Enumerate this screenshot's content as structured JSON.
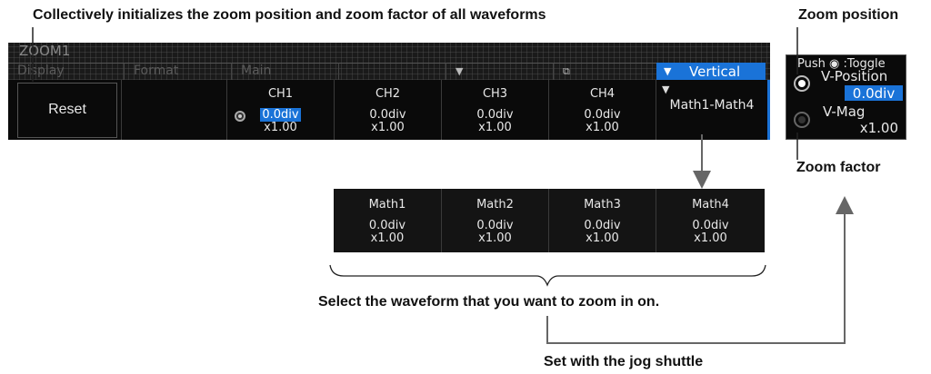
{
  "annotations": {
    "reset_note": "Collectively initializes the zoom position and zoom factor of all waveforms",
    "zoom_position": "Zoom position",
    "zoom_factor": "Zoom factor",
    "select_note": "Select the waveform that you want to zoom in on.",
    "jog_note": "Set with the jog shuttle"
  },
  "menu": {
    "title": "ZOOM1",
    "tabs": [
      "Display",
      "Format",
      "Main",
      "",
      "",
      "",
      "Vertical"
    ],
    "reset_label": "Reset",
    "channels": [
      {
        "name": "CH1",
        "position": "0.0div",
        "mag": "x1.00",
        "selected": true
      },
      {
        "name": "CH2",
        "position": "0.0div",
        "mag": "x1.00"
      },
      {
        "name": "CH3",
        "position": "0.0div",
        "mag": "x1.00"
      },
      {
        "name": "CH4",
        "position": "0.0div",
        "mag": "x1.00"
      }
    ],
    "math_group": "Math1-Math4"
  },
  "side_panel": {
    "push_toggle": "Push ◉ :Toggle",
    "v_position_label": "V-Position",
    "v_position_value": "0.0div",
    "v_mag_label": "V-Mag",
    "v_mag_value": "x1.00"
  },
  "math_table": [
    {
      "name": "Math1",
      "position": "0.0div",
      "mag": "x1.00"
    },
    {
      "name": "Math2",
      "position": "0.0div",
      "mag": "x1.00"
    },
    {
      "name": "Math3",
      "position": "0.0div",
      "mag": "x1.00"
    },
    {
      "name": "Math4",
      "position": "0.0div",
      "mag": "x1.00"
    }
  ],
  "colors": {
    "accent": "#1a73d8",
    "panel": "#141414"
  }
}
